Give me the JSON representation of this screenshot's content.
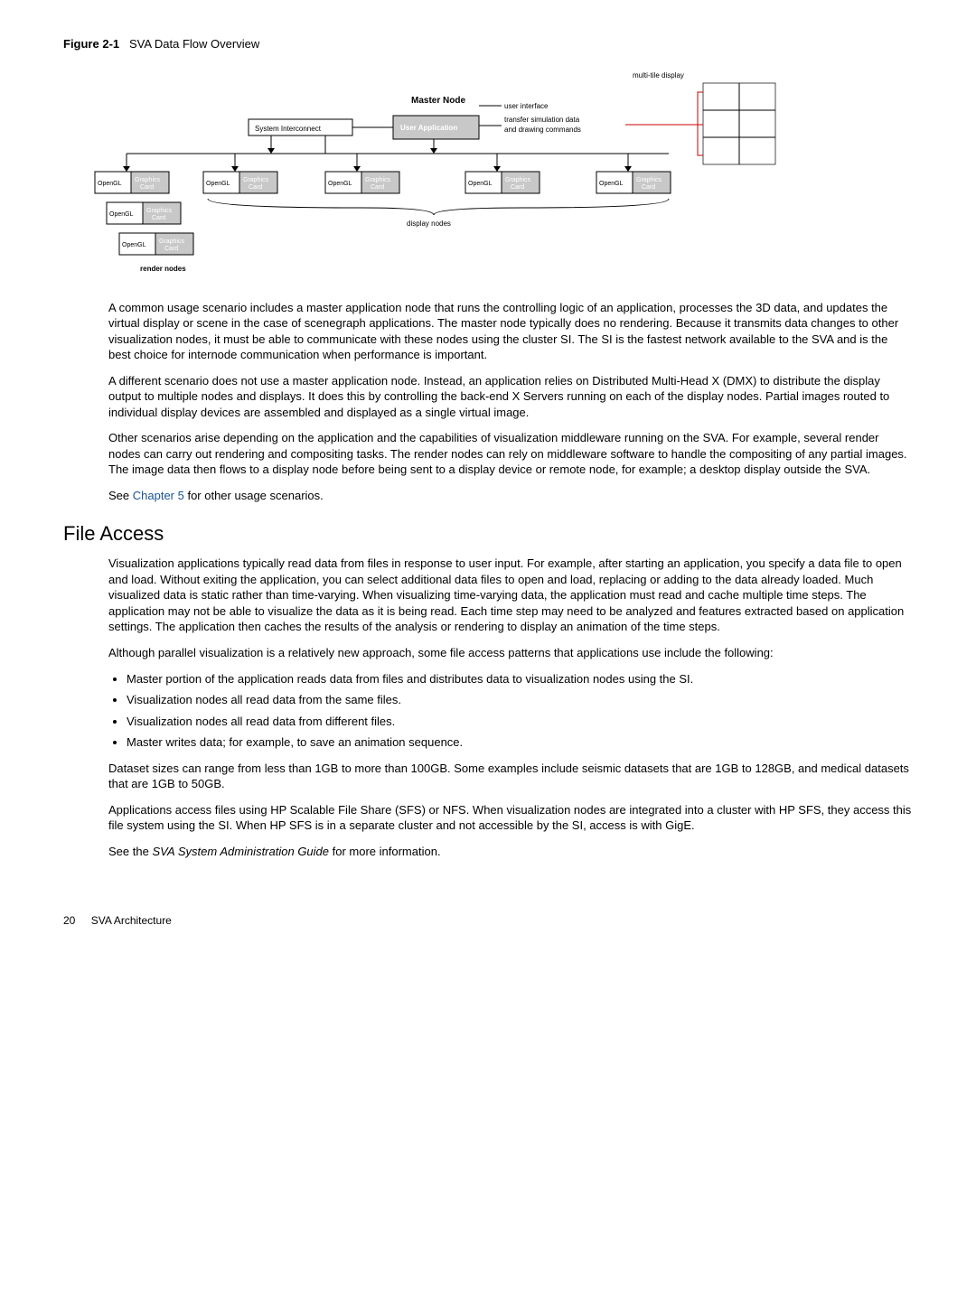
{
  "figure": {
    "label": "Figure 2-1",
    "caption": "SVA Data Flow Overview"
  },
  "diagram": {
    "multi_tile": "multi-tile display",
    "master_node": "Master Node",
    "user_app": "User Application",
    "system_interconnect": "System Interconnect",
    "user_interface": "user interface",
    "transfer": "transfer simulation data and drawing commands",
    "display_nodes": "display nodes",
    "render_nodes": "render nodes",
    "opengl": "OpenGL",
    "graphics_card": "Graphics Card"
  },
  "para1": "A common usage scenario includes a master application node that runs the controlling logic of an application, processes the 3D data, and updates the virtual display or scene in the case of scenegraph applications. The master node typically does no rendering. Because it transmits data changes to other visualization nodes, it must be able to communicate with these nodes using the cluster SI. The SI is the fastest network available to the SVA and is the best choice for internode communication when performance is important.",
  "para2": "A different scenario does not use a master application node. Instead, an application relies on Distributed Multi-Head X (DMX) to distribute the display output to multiple nodes and displays. It does this by controlling the back-end X Servers running on each of the display nodes. Partial images routed to individual display devices are assembled and displayed as a single virtual image.",
  "para3": "Other scenarios arise depending on the application and the capabilities of visualization middleware running on the SVA. For example, several render nodes can carry out rendering and compositing tasks. The render nodes can rely on middleware software to handle the compositing of any partial images. The image data then flows to a display node before being sent to a display device or remote node, for example; a desktop display outside the SVA.",
  "para4_prefix": "See ",
  "para4_link": "Chapter  5",
  "para4_suffix": " for other usage scenarios.",
  "heading": "File Access",
  "para5": "Visualization applications typically read data from files in response to user input. For example, after starting an application, you specify a data file to open and load. Without exiting the application, you can select additional data files to open and load, replacing or adding to the data already loaded. Much visualized data is static rather than time-varying. When visualizing time-varying data, the application must read and cache multiple time steps. The application may not be able to visualize the data as it is being read. Each time step may need to be analyzed and features extracted based on application settings. The application then caches the results of the analysis or rendering to display an animation of the time steps.",
  "para6": "Although parallel visualization is a relatively new approach, some file access patterns that applications use include the following:",
  "bullets": [
    "Master portion of the application reads data from files and distributes data to visualization nodes using the SI.",
    "Visualization nodes all read data from the same files.",
    "Visualization nodes all read data from different files.",
    "Master writes data; for example, to save an animation sequence."
  ],
  "para7": "Dataset sizes can range from less than 1GB to more than 100GB. Some examples include seismic datasets that are 1GB to 128GB, and medical datasets that are 1GB to 50GB.",
  "para8": "Applications access files using HP Scalable File Share (SFS) or NFS. When visualization nodes are integrated into a cluster with HP SFS, they access this file system using the SI. When HP SFS is in a separate cluster and not accessible by the SI, access is with GigE.",
  "para9_prefix": "See the ",
  "para9_italic": "SVA System Administration Guide",
  "para9_suffix": " for more information.",
  "footer": {
    "page": "20",
    "section": "SVA Architecture"
  }
}
